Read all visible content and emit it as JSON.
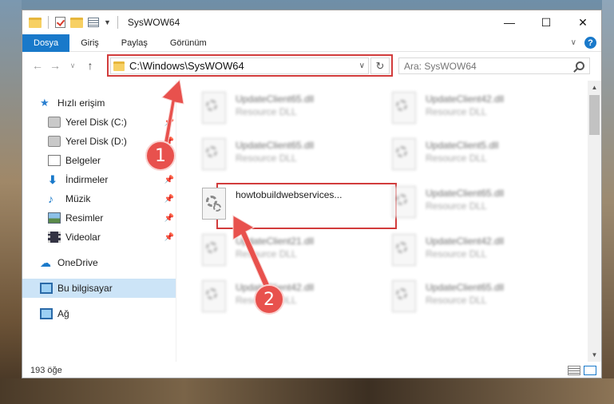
{
  "window": {
    "title": "SysWOW64"
  },
  "ribbon": {
    "tabs": [
      "Dosya",
      "Giriş",
      "Paylaş",
      "Görünüm"
    ]
  },
  "nav": {
    "address": "C:\\Windows\\SysWOW64",
    "search_placeholder": "Ara: SysWOW64"
  },
  "sidebar": {
    "quick_access": "Hızlı erişim",
    "items": [
      {
        "label": "Yerel Disk (C:)",
        "icon": "drive-icon",
        "pinned": true
      },
      {
        "label": "Yerel Disk (D:)",
        "icon": "drive-icon",
        "pinned": true
      },
      {
        "label": "Belgeler",
        "icon": "document-icon",
        "pinned": true
      },
      {
        "label": "İndirmeler",
        "icon": "download-icon",
        "pinned": true
      },
      {
        "label": "Müzik",
        "icon": "music-icon",
        "pinned": true
      },
      {
        "label": "Resimler",
        "icon": "pictures-icon",
        "pinned": true
      },
      {
        "label": "Videolar",
        "icon": "videos-icon",
        "pinned": true
      }
    ],
    "onedrive": "OneDrive",
    "this_pc": "Bu bilgisayar",
    "network": "Ağ"
  },
  "files": {
    "left": [
      {
        "name": "UpdateClient65.dll",
        "type": "Resource DLL"
      },
      {
        "name": "UpdateClient65.dll",
        "type": "Resource DLL"
      },
      {
        "name": "howtobuildwebservices...",
        "type": ""
      },
      {
        "name": "UpdateClient21.dll",
        "type": "Resource DLL"
      },
      {
        "name": "UpdateClient42.dll",
        "type": "Resource DLL"
      }
    ],
    "right": [
      {
        "name": "UpdateClient42.dll",
        "type": "Resource DLL"
      },
      {
        "name": "UpdateClient5.dll",
        "type": "Resource DLL"
      },
      {
        "name": "UpdateClient65.dll",
        "type": "Resource DLL"
      },
      {
        "name": "UpdateClient42.dll",
        "type": "Resource DLL"
      },
      {
        "name": "UpdateClient65.dll",
        "type": "Resource DLL"
      }
    ]
  },
  "status": {
    "count": "193 öğe"
  },
  "annotations": {
    "step1": "1",
    "step2": "2",
    "color": "#d23c3c"
  }
}
